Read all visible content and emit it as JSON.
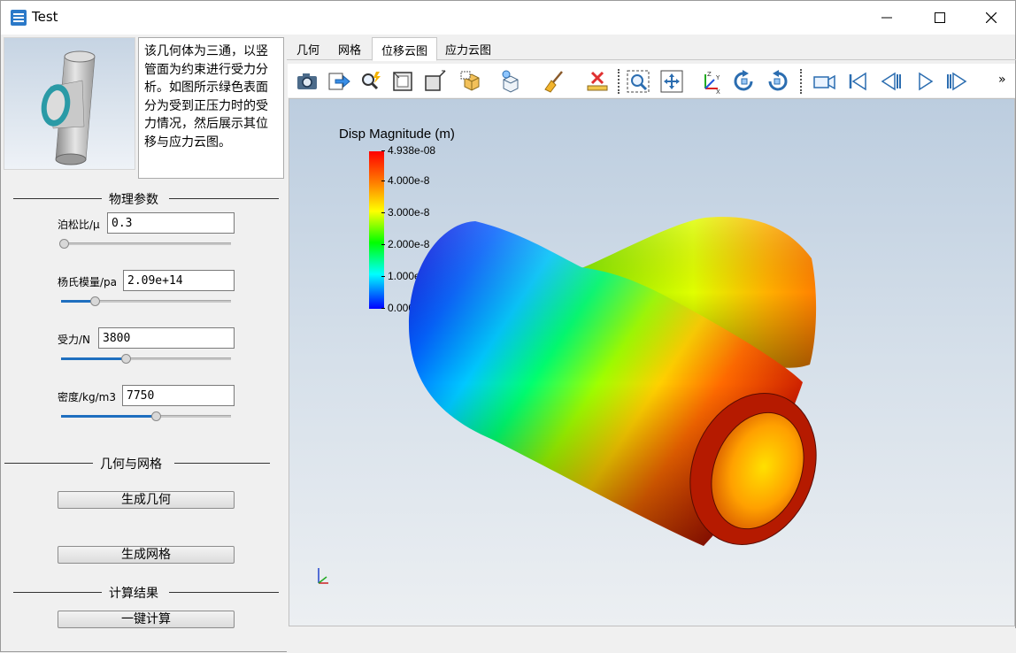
{
  "window": {
    "title": "Test"
  },
  "description": "该几何体为三通，以竖管面为约束进行受力分析。如图所示绿色表面分为受到正压力时的受力情况，然后展示其位移与应力云图。",
  "sections": {
    "physics": "物理参数",
    "geometry_mesh": "几何与网格",
    "results": "计算结果"
  },
  "params": [
    {
      "label": "泊松比/μ",
      "value": "0.3",
      "slider_fraction": 0.0
    },
    {
      "label": "杨氏模量/pa",
      "value": "2.09e+14",
      "slider_fraction": 0.2
    },
    {
      "label": "受力/N",
      "value": "3800",
      "slider_fraction": 0.38
    },
    {
      "label": "密度/kg/m3",
      "value": "7750",
      "slider_fraction": 0.56
    }
  ],
  "buttons": {
    "gen_geometry": "生成几何",
    "gen_mesh": "生成网格",
    "compute": "一键计算"
  },
  "tabs": [
    {
      "label": "几何",
      "active": false
    },
    {
      "label": "网格",
      "active": false
    },
    {
      "label": "位移云图",
      "active": true
    },
    {
      "label": "应力云图",
      "active": false
    }
  ],
  "toolbar": {
    "icons": [
      "camera-icon",
      "export-icon",
      "zoom-pick-icon",
      "fit-view-icon",
      "box-view-icon",
      "surface-display-icon",
      "wireframe-display-icon",
      "clear-icon",
      "delete-icon",
      "zoom-region-icon",
      "pan-icon",
      "axes-icon",
      "rotate-cw-icon",
      "rotate-ccw-icon",
      "video-icon",
      "first-frame-icon",
      "prev-frame-icon",
      "play-icon",
      "next-frame-icon"
    ],
    "more": "»"
  },
  "colorbar": {
    "title": "Disp Magnitude (m)",
    "ticks": [
      "4.938e-08",
      "4.000e-8",
      "3.000e-8",
      "2.000e-8",
      "1.000e-8",
      "0.000e+00"
    ]
  },
  "colors": {
    "accent": "#1f6fbf",
    "pipe_ring": "#2a9aa6"
  }
}
